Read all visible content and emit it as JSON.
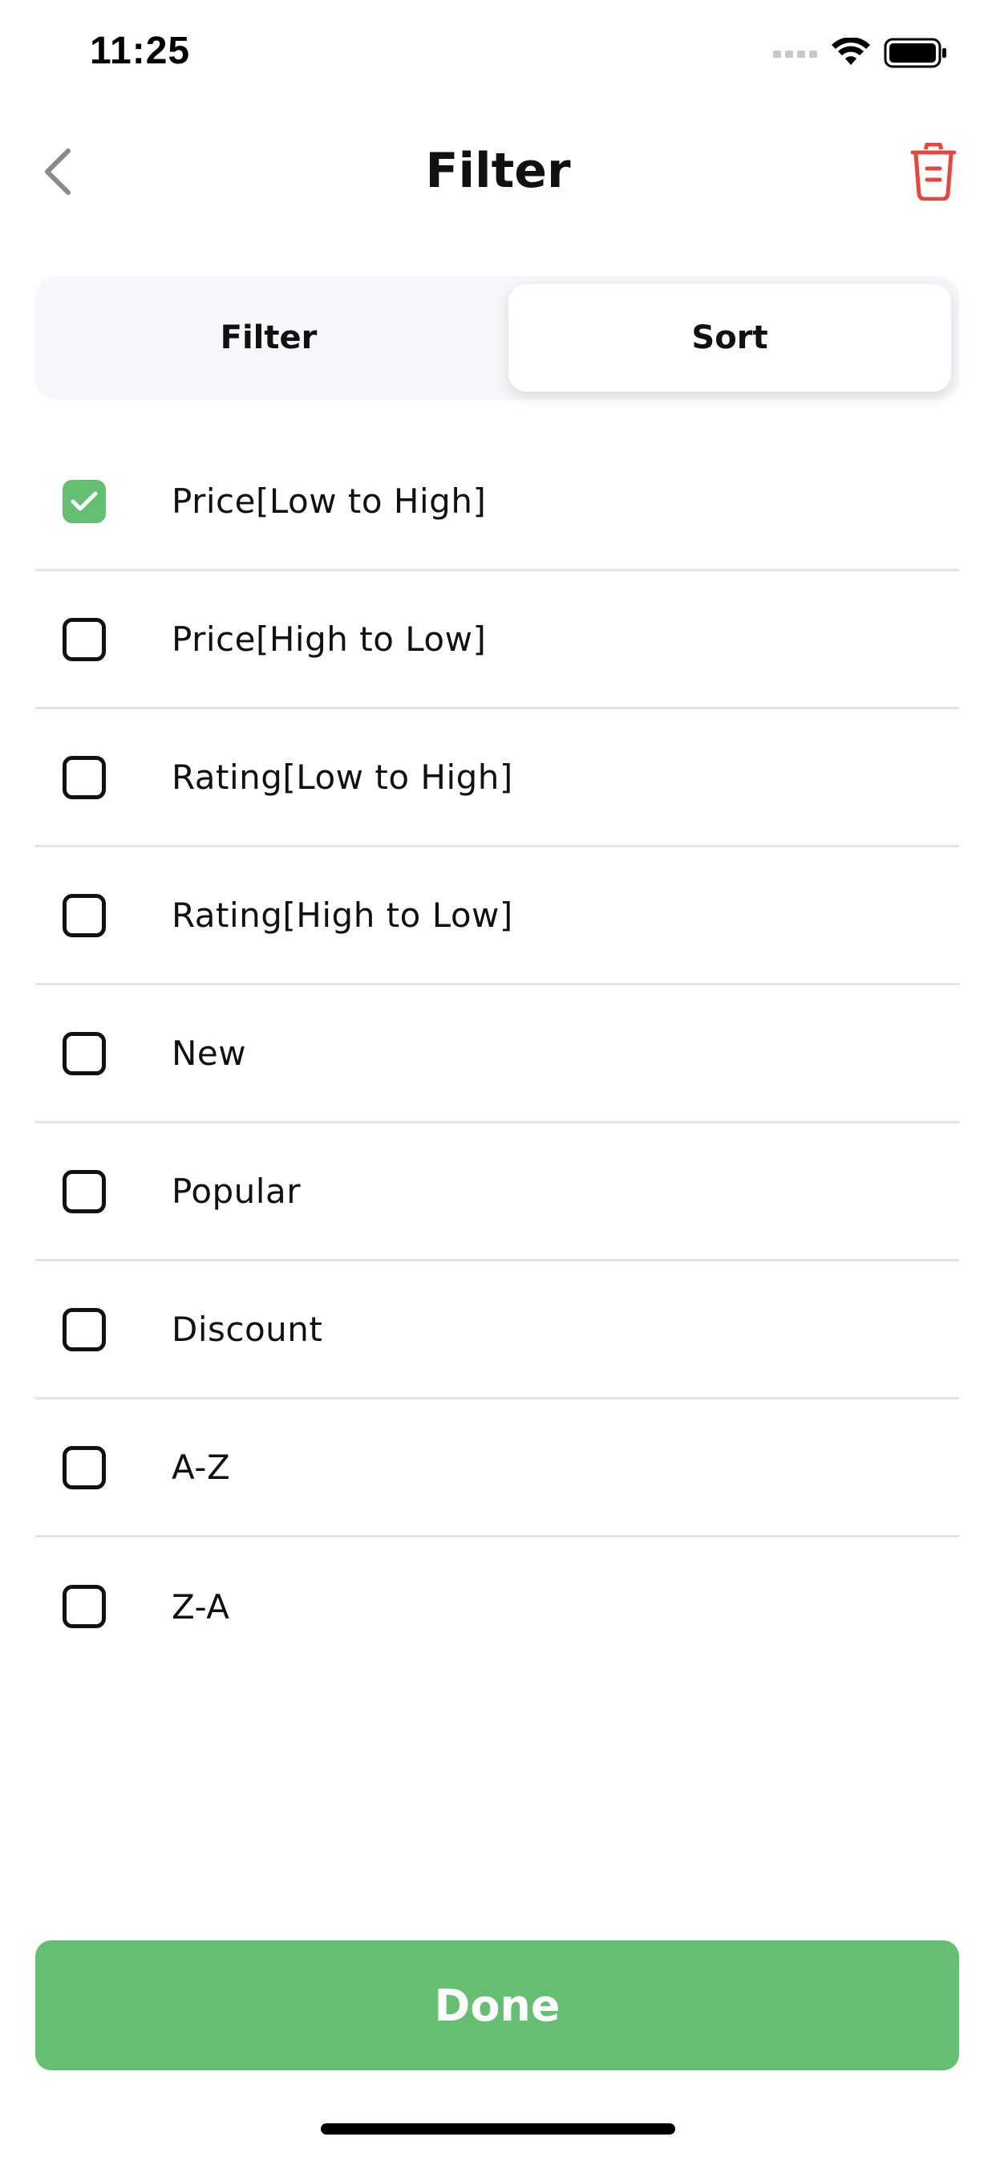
{
  "status_bar": {
    "time": "11:25",
    "icons": [
      "signal-dots-icon",
      "wifi-icon",
      "battery-icon"
    ]
  },
  "header": {
    "title": "Filter",
    "back_icon": "chevron-left-icon",
    "delete_icon": "trash-icon"
  },
  "tabs": [
    {
      "label": "Filter",
      "selected": false
    },
    {
      "label": "Sort",
      "selected": true
    }
  ],
  "sort_options": [
    {
      "label": "Price[Low to High]",
      "checked": true
    },
    {
      "label": "Price[High to Low]",
      "checked": false
    },
    {
      "label": "Rating[Low to High]",
      "checked": false
    },
    {
      "label": "Rating[High to Low]",
      "checked": false
    },
    {
      "label": "New",
      "checked": false
    },
    {
      "label": "Popular",
      "checked": false
    },
    {
      "label": "Discount",
      "checked": false
    },
    {
      "label": "A-Z",
      "checked": false
    },
    {
      "label": "Z-A",
      "checked": false
    }
  ],
  "done_button": {
    "label": "Done"
  },
  "colors": {
    "accent_green": "#64bf72",
    "delete_red": "#e5483b",
    "segment_bg": "#f6f7fb",
    "divider": "#e4e4e6"
  }
}
